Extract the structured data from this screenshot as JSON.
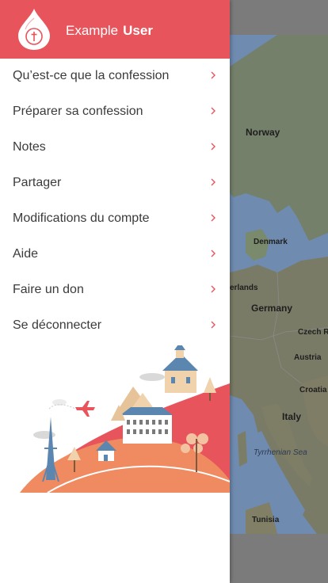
{
  "header": {
    "first_name": "Example",
    "last_name": "User"
  },
  "menu": {
    "items": [
      {
        "label": "Qu’est-ce que la confession"
      },
      {
        "label": "Préparer sa confession"
      },
      {
        "label": "Notes"
      },
      {
        "label": "Partager"
      },
      {
        "label": "Modifications du compte"
      },
      {
        "label": "Aide"
      },
      {
        "label": "Faire un don"
      },
      {
        "label": "Se déconnecter"
      }
    ]
  },
  "map": {
    "labels": {
      "norway": "Norway",
      "denmark": "Denmark",
      "netherlands": "erlands",
      "germany": "Germany",
      "czech": "Czech R",
      "austria": "Austria",
      "croatia": "Croatia",
      "italy": "Italy",
      "sea": "Tyrrhenian Sea",
      "tunisia": "Tunisia"
    }
  },
  "colors": {
    "brand": "#e8545c",
    "menu_text": "#3b3b3b",
    "chevron": "#e8545c",
    "scrim": "#7b7b7b"
  },
  "icons": {
    "logo": "drop-logo-icon",
    "chevron": "chevron-right-icon"
  }
}
